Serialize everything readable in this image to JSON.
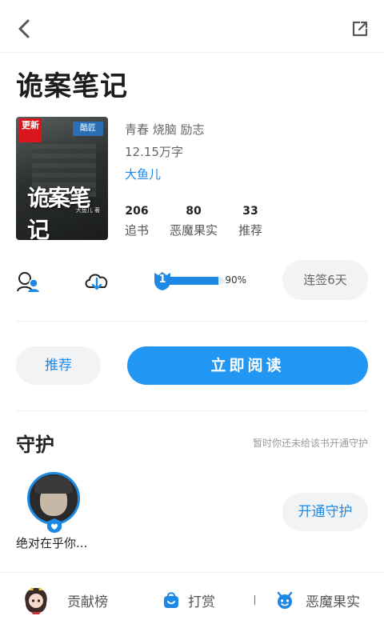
{
  "book": {
    "title": "诡案笔记",
    "tags": "青春 烧脑 励志",
    "word_count": "12.15万字",
    "author": "大鱼儿",
    "cover": {
      "badge": "更新",
      "logo": "酷匠",
      "cover_title": "诡案笔记",
      "cover_author": "大鱼儿 著"
    }
  },
  "stats": [
    {
      "value": "206",
      "label": "追书"
    },
    {
      "value": "80",
      "label": "恶魔果实"
    },
    {
      "value": "33",
      "label": "推荐"
    }
  ],
  "level": {
    "number": "1",
    "percent_text": "90%",
    "progress": 0.9
  },
  "checkin_label": "连签6天",
  "buttons": {
    "recommend": "推荐",
    "read_now": "立即阅读"
  },
  "guard": {
    "title": "守护",
    "tip": "暂时你还未给该书开通守护",
    "guardian_name": "绝对在乎你...",
    "open_button": "开通守护"
  },
  "bottom_bar": {
    "contribution": "贡献榜",
    "reward": "打赏",
    "fruit": "恶魔果实"
  },
  "colors": {
    "accent": "#2196f3",
    "link": "#1e88e5",
    "badge_red": "#d8161b"
  },
  "icons": [
    "back-arrow-icon",
    "share-icon",
    "fans-icon",
    "download-cloud-icon",
    "level-shield-icon",
    "fan-badge-icon",
    "contribution-avatar-icon",
    "reward-bag-icon",
    "devil-fruit-icon"
  ]
}
